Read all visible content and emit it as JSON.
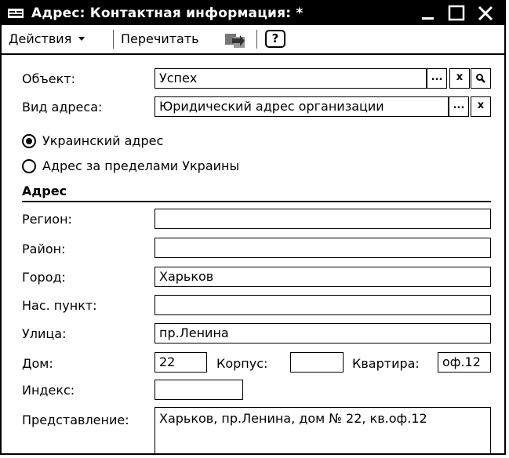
{
  "window": {
    "title": "Адрес: Контактная информация:  *"
  },
  "toolbar": {
    "actions_label": "Действия",
    "reread_label": "Перечитать",
    "help_label": "?"
  },
  "form": {
    "object_label": "Объект:",
    "object_value": "Успех",
    "addr_type_label": "Вид адреса:",
    "addr_type_value": "Юридический адрес организации",
    "ellipsis": "...",
    "clear": "x"
  },
  "radio": {
    "ukraine_label": "Украинский адрес",
    "abroad_label": "Адрес за пределами Украины"
  },
  "address": {
    "section_title": "Адрес",
    "region_label": "Регион:",
    "region_value": "",
    "district_label": "Район:",
    "district_value": "",
    "city_label": "Город:",
    "city_value": "Харьков",
    "settlement_label": "Нас. пункт:",
    "settlement_value": "",
    "street_label": "Улица:",
    "street_value": "пр.Ленина",
    "house_label": "Дом:",
    "house_value": "22",
    "building_label": "Корпус:",
    "building_value": "",
    "apartment_label": "Квартира:",
    "apartment_value": "оф.12",
    "index_label": "Индекс:",
    "index_value": "",
    "representation_label": "Представление:",
    "representation_value": "Харьков, пр.Ленина, дом № 22, кв.оф.12"
  }
}
